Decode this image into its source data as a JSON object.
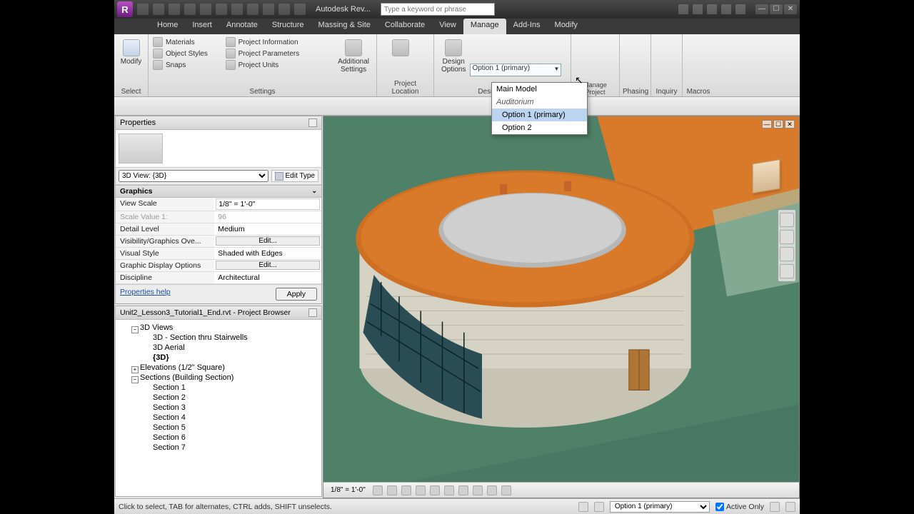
{
  "title_app": "Autodesk Rev...",
  "search_placeholder": "Type a keyword or phrase",
  "tabs": [
    "Home",
    "Insert",
    "Annotate",
    "Structure",
    "Massing & Site",
    "Collaborate",
    "View",
    "Manage",
    "Add-Ins",
    "Modify"
  ],
  "active_tab": "Manage",
  "ribbon": {
    "select": {
      "modify": "Modify",
      "label": "Select"
    },
    "settings": {
      "materials": "Materials",
      "object_styles": "Object Styles",
      "snaps": "Snaps",
      "project_info": "Project Information",
      "project_params": "Project Parameters",
      "project_units": "Project Units",
      "additional": "Additional\nSettings",
      "label": "Settings"
    },
    "project_location": {
      "label": "Project Location"
    },
    "design_options": {
      "big": "Design\nOptions",
      "selected": "Option 1 (primary)",
      "label": "Design Options"
    },
    "manage_project": "Manage Project",
    "phasing": "Phasing",
    "inquiry": "Inquiry",
    "macros": "Macros"
  },
  "dropdown": {
    "items": [
      {
        "label": "Main Model",
        "type": "item"
      },
      {
        "label": "Auditorium",
        "type": "group"
      },
      {
        "label": "Option 1 (primary)",
        "type": "sub",
        "hover": true
      },
      {
        "label": "Option 2",
        "type": "sub"
      }
    ]
  },
  "properties": {
    "title": "Properties",
    "type_selector": "3D View: {3D}",
    "edit_type": "Edit Type",
    "section": "Graphics",
    "rows": [
      {
        "k": "View Scale",
        "v": "1/8\" = 1'-0\"",
        "input": true
      },
      {
        "k": "Scale Value    1:",
        "v": "96",
        "dim": true
      },
      {
        "k": "Detail Level",
        "v": "Medium"
      },
      {
        "k": "Visibility/Graphics Ove...",
        "v": "Edit...",
        "btn": true
      },
      {
        "k": "Visual Style",
        "v": "Shaded with Edges"
      },
      {
        "k": "Graphic Display Options",
        "v": "Edit...",
        "btn": true
      },
      {
        "k": "Discipline",
        "v": "Architectural"
      }
    ],
    "help": "Properties help",
    "apply": "Apply"
  },
  "browser": {
    "title": "Unit2_Lesson3_Tutorial1_End.rvt - Project Browser",
    "tree": [
      {
        "label": "3D Views",
        "lvl": 1,
        "state": "expanded"
      },
      {
        "label": "3D - Section thru Stairwells",
        "lvl": 2,
        "leaf": true
      },
      {
        "label": "3D Aerial",
        "lvl": 2,
        "leaf": true
      },
      {
        "label": "{3D}",
        "lvl": 2,
        "leaf": true,
        "bold": true
      },
      {
        "label": "Elevations (1/2\" Square)",
        "lvl": 1,
        "state": "collapsed"
      },
      {
        "label": "Sections (Building Section)",
        "lvl": 1,
        "state": "expanded"
      },
      {
        "label": "Section 1",
        "lvl": 2,
        "leaf": true
      },
      {
        "label": "Section 2",
        "lvl": 2,
        "leaf": true
      },
      {
        "label": "Section 3",
        "lvl": 2,
        "leaf": true
      },
      {
        "label": "Section 4",
        "lvl": 2,
        "leaf": true
      },
      {
        "label": "Section 5",
        "lvl": 2,
        "leaf": true
      },
      {
        "label": "Section 6",
        "lvl": 2,
        "leaf": true
      },
      {
        "label": "Section 7",
        "lvl": 2,
        "leaf": true
      }
    ]
  },
  "viewctrl_scale": "1/8\" = 1'-0\"",
  "status": {
    "hint": "Click to select, TAB for alternates, CTRL adds, SHIFT unselects.",
    "option_combo": "Option 1 (primary)",
    "active_only": "Active Only"
  }
}
